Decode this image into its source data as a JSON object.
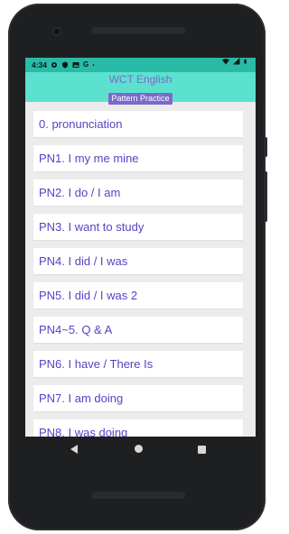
{
  "status_bar": {
    "time": "4:34",
    "left_icons": [
      "settings-icon",
      "shield-icon",
      "photo-icon",
      "google-icon",
      "dot-icon"
    ],
    "right_icons": [
      "wifi-icon",
      "signal-icon",
      "battery-icon"
    ],
    "google_letter": "G"
  },
  "app_header": {
    "title": "WCT English",
    "subtitle": "Pattern Practice"
  },
  "list": {
    "items": [
      "0. pronunciation",
      "PN1. I my me mine",
      "PN2. I do / I am",
      "PN3. I want to study",
      "PN4. I did / I was",
      "PN5. I did / I was 2",
      "PN4~5. Q & A",
      "PN6. I have / There Is",
      "PN7. I am doing",
      "PN8. I was doing"
    ]
  },
  "colors": {
    "status_bar": "#29bba6",
    "header": "#5ce1cf",
    "accent": "#7b6ac8",
    "item_text": "#5b3fc4",
    "background": "#ececec"
  },
  "nav_bar": {
    "buttons": [
      "back-icon",
      "home-icon",
      "recent-apps-icon"
    ]
  }
}
